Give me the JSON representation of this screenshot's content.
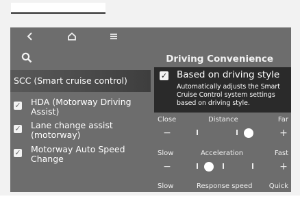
{
  "nav": {
    "back_icon": "back-arrow-icon",
    "home_icon": "home-icon",
    "menu_icon": "menu-icon",
    "search_icon": "search-icon"
  },
  "left": {
    "selected_label": "SCC (Smart cruise control)",
    "items": [
      {
        "label": "HDA (Motorway Driving Assist)",
        "checked": true
      },
      {
        "label": "Lane change assist (motorway)",
        "checked": true
      },
      {
        "label": "Motorway Auto Speed Change",
        "checked": true
      }
    ]
  },
  "right": {
    "title": "Driving Convenience",
    "option_title": "Based on driving style",
    "option_checked": true,
    "option_desc": "Automatically adjusts the Smart Cruise Control system settings based on driving style.",
    "sliders": [
      {
        "name": "Distance",
        "left": "Close",
        "right": "Far",
        "level": 0.82
      },
      {
        "name": "Acceleration",
        "left": "Slow",
        "right": "Fast",
        "level": 0.33
      },
      {
        "name": "Response speed",
        "left": "Slow",
        "right": "Quick",
        "level": null
      }
    ]
  },
  "colors": {
    "screen_bg": "#6d6d6d",
    "panel_dark": "#2a2a2a",
    "text": "#ffffff"
  }
}
